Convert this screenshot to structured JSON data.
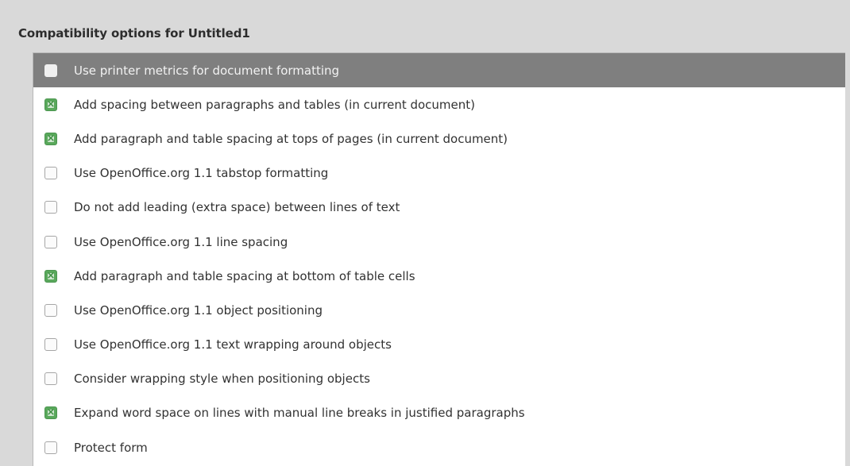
{
  "frame": {
    "title": "Compatibility options for Untitled1"
  },
  "options": [
    {
      "label": "Use printer metrics for document formatting",
      "checked": false,
      "selected": true
    },
    {
      "label": "Add spacing between paragraphs and tables (in current document)",
      "checked": true,
      "selected": false
    },
    {
      "label": "Add paragraph and table spacing at tops of pages (in current document)",
      "checked": true,
      "selected": false
    },
    {
      "label": "Use OpenOffice.org 1.1 tabstop formatting",
      "checked": false,
      "selected": false
    },
    {
      "label": "Do not add leading (extra space) between lines of text",
      "checked": false,
      "selected": false
    },
    {
      "label": "Use OpenOffice.org 1.1 line spacing",
      "checked": false,
      "selected": false
    },
    {
      "label": "Add paragraph and table spacing at bottom of table cells",
      "checked": true,
      "selected": false
    },
    {
      "label": "Use OpenOffice.org 1.1 object positioning",
      "checked": false,
      "selected": false
    },
    {
      "label": "Use OpenOffice.org 1.1 text wrapping around objects",
      "checked": false,
      "selected": false
    },
    {
      "label": "Consider wrapping style when positioning objects",
      "checked": false,
      "selected": false
    },
    {
      "label": "Expand word space on lines with manual line breaks in justified paragraphs",
      "checked": true,
      "selected": false
    },
    {
      "label": "Protect form",
      "checked": false,
      "selected": false
    }
  ],
  "colors": {
    "selection": "#7f7f7f",
    "checked": "#59a85b",
    "background": "#d9d9d9"
  }
}
